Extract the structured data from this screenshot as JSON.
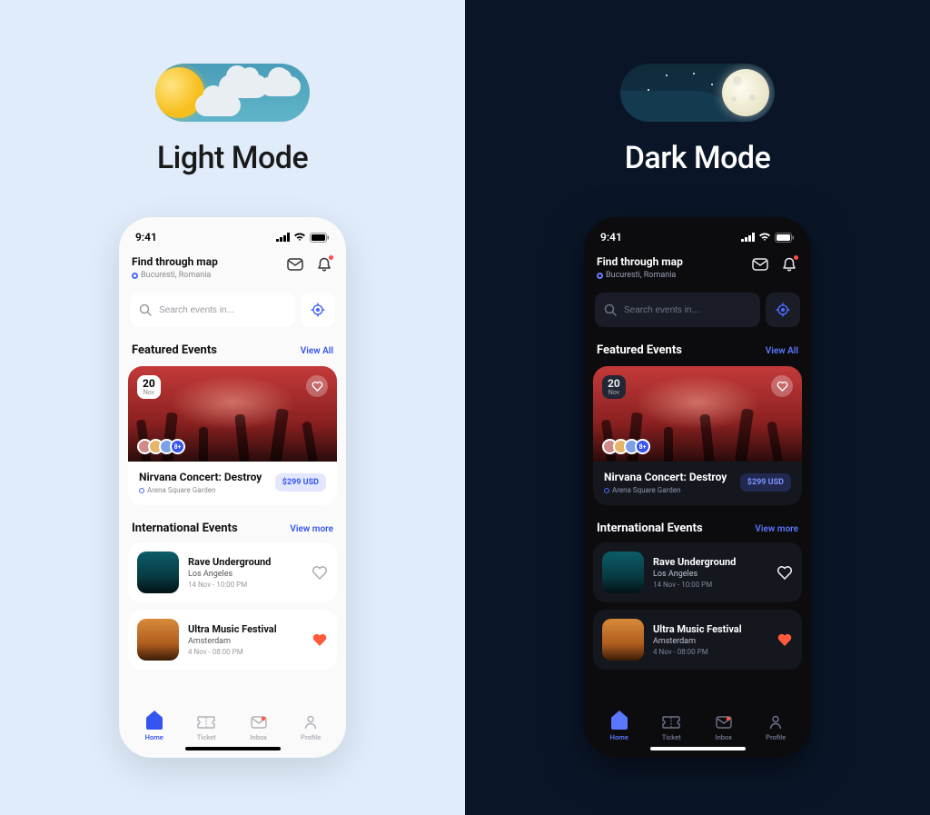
{
  "modes": {
    "light_label": "Light Mode",
    "dark_label": "Dark Mode"
  },
  "status": {
    "time": "9:41"
  },
  "header": {
    "title": "Find through map",
    "location": "Bucuresti, Romania"
  },
  "search": {
    "placeholder": "Search events in..."
  },
  "featured": {
    "section_title": "Featured Events",
    "view_all": "View All",
    "date_day": "20",
    "date_month": "Nov",
    "avatars_more": "8+",
    "title": "Nirvana Concert: Destroy",
    "venue": "Arena Square Garden",
    "price": "$299 USD"
  },
  "international": {
    "section_title": "International Events",
    "view_more": "View more",
    "events": [
      {
        "title": "Rave Underground",
        "city": "Los Angeles",
        "date": "14 Nov - 10:00 PM",
        "liked": false
      },
      {
        "title": "Ultra Music Festival",
        "city": "Amsterdam",
        "date": "4 Nov - 08:00 PM",
        "liked": true
      }
    ]
  },
  "tabs": {
    "home": "Home",
    "ticket": "Ticket",
    "inbox": "Inbox",
    "profile": "Profile"
  }
}
